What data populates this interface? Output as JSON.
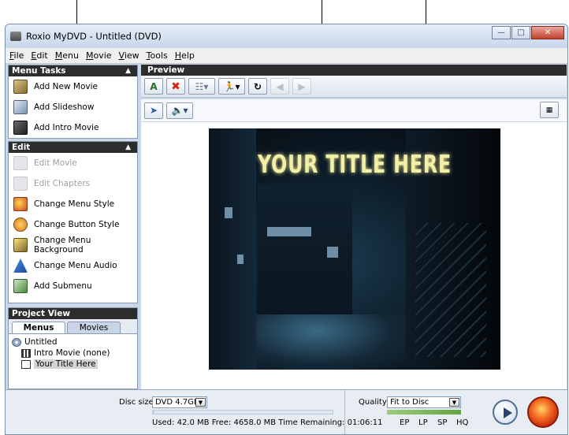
{
  "window": {
    "title": "Roxio MyDVD - Untitled (DVD)"
  },
  "menu": [
    "File",
    "Edit",
    "Menu",
    "Movie",
    "View",
    "Tools",
    "Help"
  ],
  "menu_tasks": {
    "header": "Menu Tasks",
    "items": [
      "Add New Movie",
      "Add Slideshow",
      "Add Intro Movie"
    ]
  },
  "edit_panel": {
    "header": "Edit",
    "items": [
      {
        "label": "Edit Movie",
        "enabled": false
      },
      {
        "label": "Edit Chapters",
        "enabled": false
      },
      {
        "label": "Change Menu Style",
        "enabled": true
      },
      {
        "label": "Change Button Style",
        "enabled": true
      },
      {
        "label": "Change Menu Background",
        "enabled": true
      },
      {
        "label": "Change Menu Audio",
        "enabled": true
      },
      {
        "label": "Add Submenu",
        "enabled": true
      }
    ]
  },
  "project_view": {
    "header": "Project View",
    "tabs": [
      "Menus",
      "Movies"
    ],
    "active_tab": "Menus",
    "tree": {
      "root": "Untitled",
      "children": [
        "Intro Movie (none)",
        "Your Title Here"
      ],
      "selected": "Your Title Here"
    }
  },
  "preview": {
    "header": "Preview",
    "menu_title": "YOUR TITLE HERE"
  },
  "status": {
    "disc_size_label": "Disc size:",
    "disc_size_value": "DVD 4.7GB",
    "usage_text": "Used: 42.0 MB  Free: 4658.0 MB  Time Remaining: 01:06:11",
    "used_fraction": 0.009,
    "quality_label": "Quality:",
    "quality_value": "Fit to Disc",
    "quality_levels": [
      "EP",
      "LP",
      "SP",
      "HQ"
    ]
  },
  "colors": {
    "panel_header": "#2d2d2d",
    "title_glow": "#f2efa6",
    "quality_bar": "#63a441",
    "burn_button": "#f36a20"
  }
}
